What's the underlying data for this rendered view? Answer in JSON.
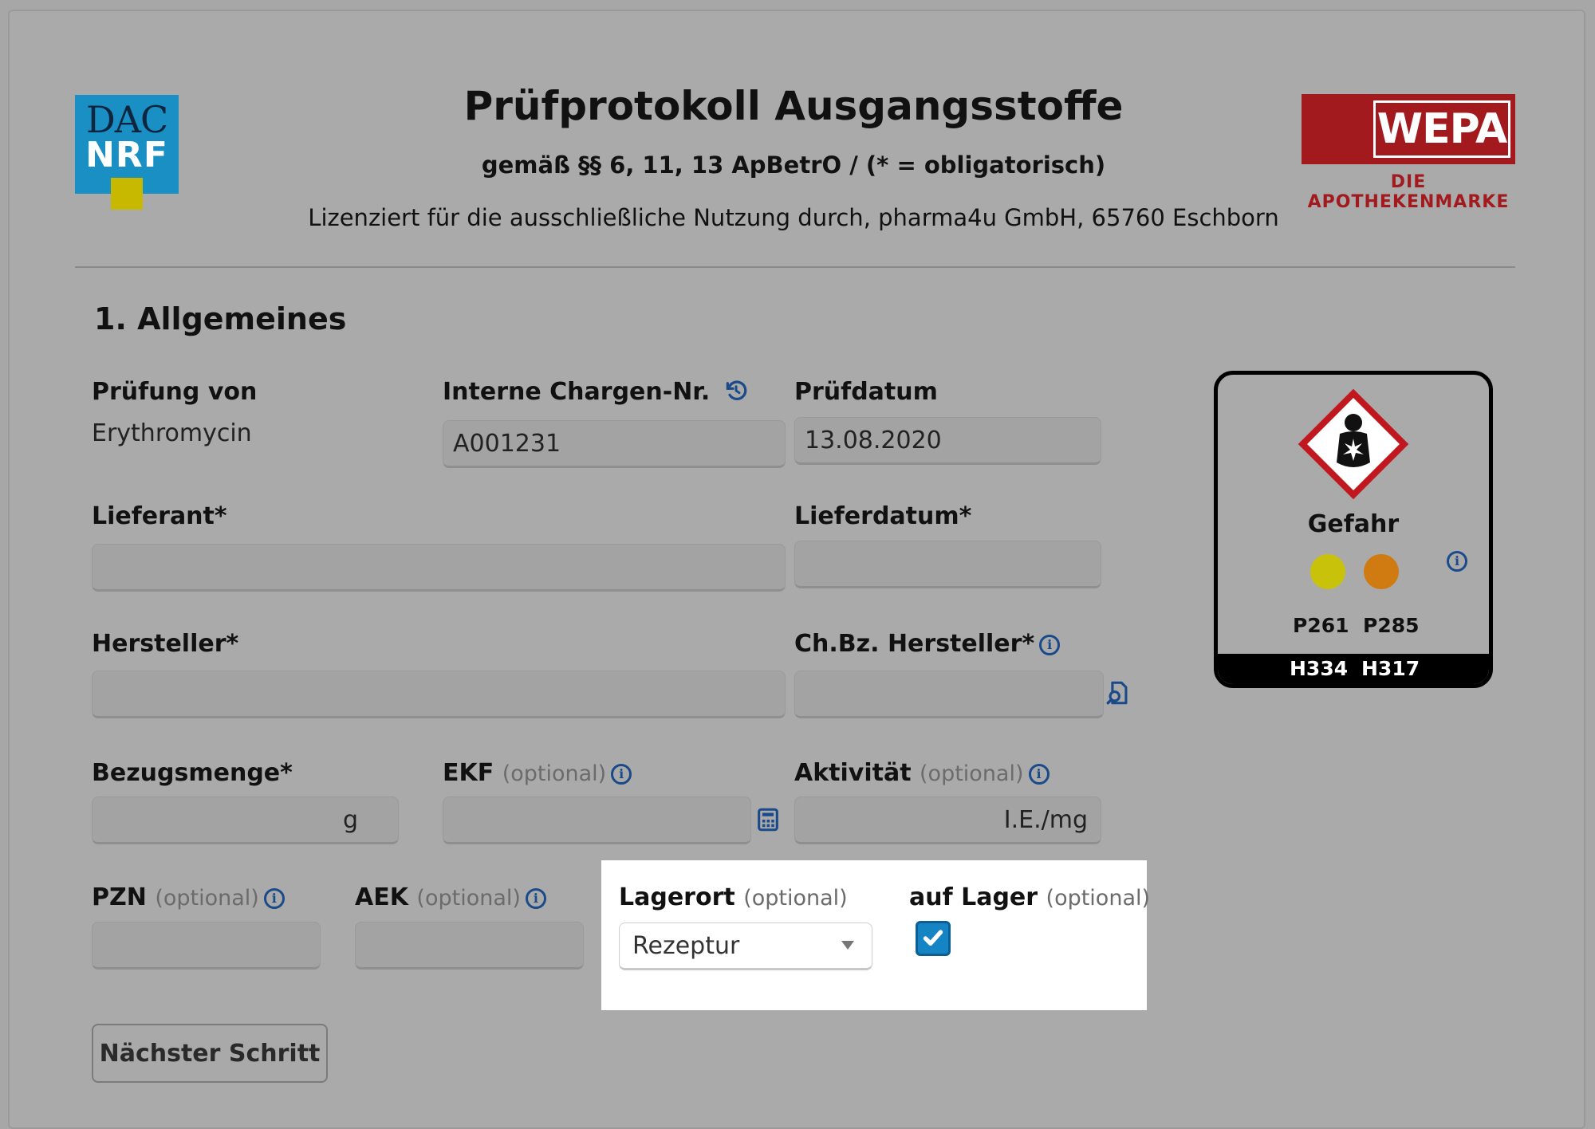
{
  "header": {
    "dac_logo": {
      "line1": "DAC",
      "line2": "NRF",
      "color": "#1a8fc4"
    },
    "wepa_logo": {
      "name": "WEPA",
      "tagline": "DIE APOTHEKENMARKE",
      "color": "#a31a1e"
    },
    "title": "Prüfprotokoll Ausgangsstoffe",
    "subtitle": "gemäß §§ 6, 11, 13 ApBetrO / (* = obligatorisch)",
    "license": "Lizenziert für die ausschließliche Nutzung durch, pharma4u GmbH, 65760 Eschborn"
  },
  "section": {
    "title": "1. Allgemeines"
  },
  "form": {
    "pruefung_von": {
      "label": "Prüfung von",
      "value": "Erythromycin"
    },
    "chargen_nr": {
      "label": "Interne Chargen-Nr.",
      "value": "A001231",
      "icon": "history-icon"
    },
    "pruefdatum": {
      "label": "Prüfdatum",
      "value": "13.08.2020"
    },
    "lieferant": {
      "label": "Lieferant*",
      "value": ""
    },
    "lieferdatum": {
      "label": "Lieferdatum*",
      "value": ""
    },
    "hersteller": {
      "label": "Hersteller*",
      "value": ""
    },
    "chbz_hersteller": {
      "label": "Ch.Bz. Hersteller*",
      "value": "",
      "icon": "document-search-icon"
    },
    "bezugsmenge": {
      "label": "Bezugsmenge*",
      "unit": "g"
    },
    "ekf": {
      "label": "EKF",
      "optional": "(optional)",
      "icon": "calculator-icon"
    },
    "aktivitaet": {
      "label": "Aktivität",
      "optional": "(optional)",
      "unit": "I.E./mg"
    },
    "pzn": {
      "label": "PZN",
      "optional": "(optional)"
    },
    "aek": {
      "label": "AEK",
      "optional": "(optional)"
    },
    "lagerort": {
      "label": "Lagerort",
      "optional": "(optional)",
      "selected": "Rezeptur"
    },
    "auf_lager": {
      "label": "auf Lager",
      "optional": "(optional)",
      "checked": true
    }
  },
  "hazard": {
    "signal_word": "Gefahr",
    "pictogram": "health-hazard-icon",
    "dot_colors": [
      "#c9c20a",
      "#d07a12"
    ],
    "p_codes": [
      "P261",
      "P285"
    ],
    "h_codes": [
      "H334",
      "H317"
    ]
  },
  "buttons": {
    "next": "Nächster Schritt"
  }
}
